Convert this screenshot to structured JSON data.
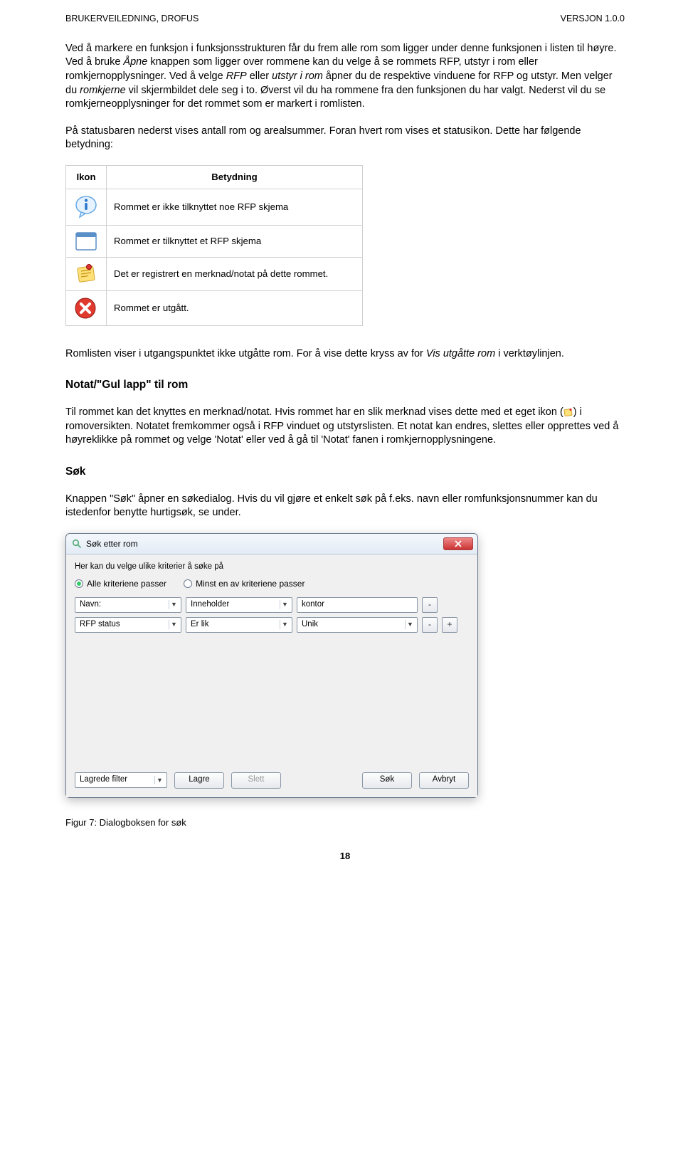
{
  "header": {
    "left": "BRUKERVEILEDNING, DROFUS",
    "right": "VERSJON 1.0.0"
  },
  "para1_pre": "Ved å markere en funksjon i funksjonsstrukturen får du frem alle rom som ligger under denne funksjonen i listen til høyre. Ved å bruke ",
  "para1_i1": "Åpne",
  "para1_mid1": " knappen som ligger over rommene kan du velge å se rommets RFP, utstyr i rom eller romkjernopplysninger. Ved å velge ",
  "para1_i2": "RFP",
  "para1_mid2": " eller ",
  "para1_i3": "utstyr i rom",
  "para1_mid3": " åpner du de respektive vinduene for RFP og utstyr. Men velger du ",
  "para1_i4": "romkjerne",
  "para1_post": " vil skjermbildet dele seg i to. Øverst vil du ha rommene fra den funksjonen du har valgt. Nederst vil du se romkjerneopplysninger for det rommet som er markert i romlisten.",
  "para2": "På statusbaren nederst vises antall rom og arealsummer. Foran hvert rom vises et statusikon. Dette har følgende betydning:",
  "table": {
    "head_icon": "Ikon",
    "head_meaning": "Betydning",
    "rows": [
      {
        "icon": "info",
        "text": "Rommet er ikke tilknyttet noe RFP skjema"
      },
      {
        "icon": "window",
        "text": "Rommet er tilknyttet et RFP skjema"
      },
      {
        "icon": "note",
        "text": "Det er registrert en merknad/notat på dette rommet."
      },
      {
        "icon": "error",
        "text": "Rommet er utgått."
      }
    ]
  },
  "romliste_pre": "Romlisten viser i utgangspunktet ikke utgåtte rom. For å vise dette kryss av for ",
  "romliste_i": "Vis utgåtte rom",
  "romliste_post": " i verktøylinjen.",
  "h_notat": "Notat/\"Gul lapp\" til rom",
  "notat_text": "Til rommet kan det knyttes en merknad/notat. Hvis rommet har en slik merknad vises dette med et eget ikon ( ) i romoversikten. Notatet fremkommer også i RFP vinduet og utstyrslisten. Et notat kan endres, slettes eller opprettes ved å høyreklikke på rommet og velge 'Notat' eller ved å gå til 'Notat' fanen i romkjernopplysningene.",
  "h_sok": "Søk",
  "sok_text": "Knappen \"Søk\" åpner en søkedialog. Hvis du vil gjøre et enkelt søk på f.eks. navn eller romfunksjonsnummer kan du istedenfor benytte hurtigsøk, se under.",
  "dialog": {
    "title": "Søk etter rom",
    "instruction": "Her kan du velge ulike kriterier å søke på",
    "radio_all": "Alle kriteriene passer",
    "radio_one": "Minst en av kriteriene passer",
    "row1": {
      "field": "Navn:",
      "op": "Inneholder",
      "val": "kontor"
    },
    "row2": {
      "field": "RFP status",
      "op": "Er lik",
      "val": "Unik"
    },
    "btn_saved": "Lagrede filter",
    "btn_save": "Lagre",
    "btn_delete": "Slett",
    "btn_search": "Søk",
    "btn_cancel": "Avbryt"
  },
  "figcaption": "Figur 7: Dialogboksen for søk",
  "pagenum": "18"
}
